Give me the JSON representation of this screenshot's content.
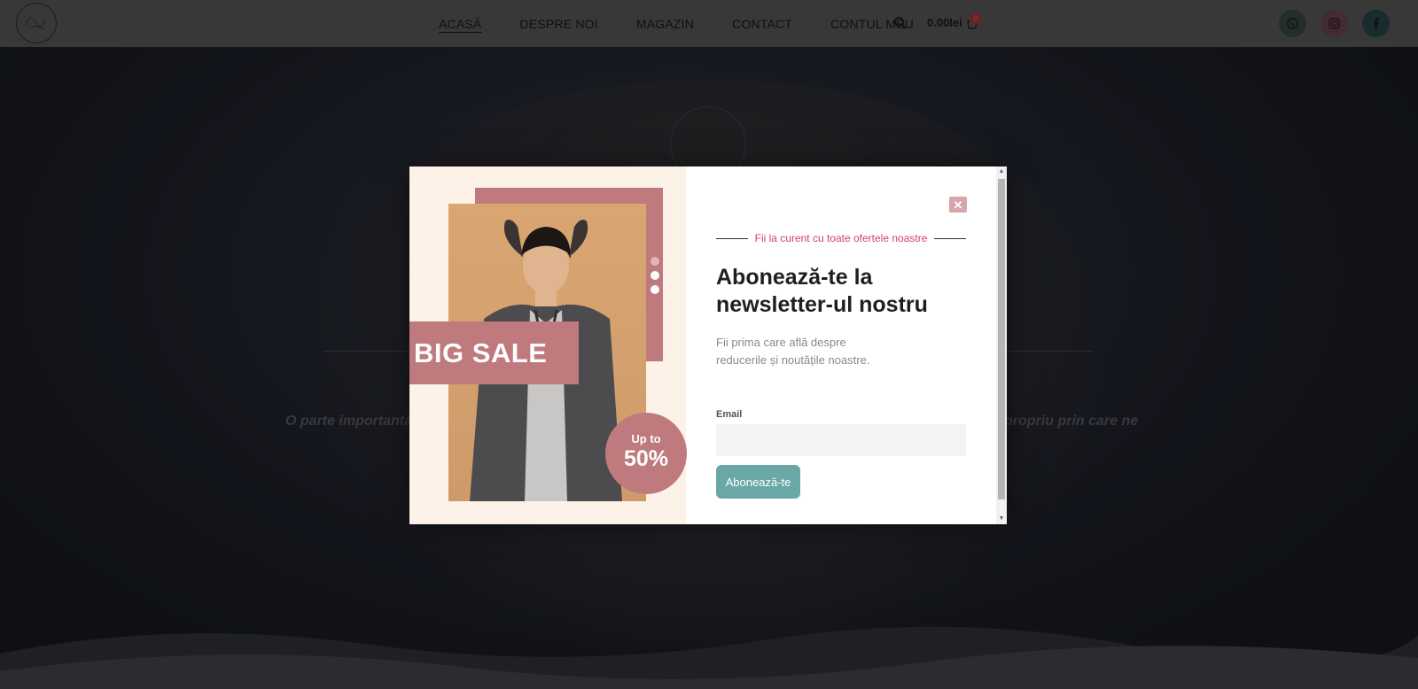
{
  "header": {
    "nav": [
      "ACASĂ",
      "DESPRE NOI",
      "MAGAZIN",
      "CONTACT",
      "CONTUL MEU"
    ],
    "cart_total": "0.00lei",
    "cart_count": "0",
    "icons": [
      "search-icon",
      "cart-icon",
      "whatsapp-icon",
      "instagram-icon",
      "facebook-icon"
    ],
    "social_colors": {
      "whatsapp": "#2f3e38",
      "instagram": "#5a3a47",
      "facebook": "#233a40"
    }
  },
  "hero": {
    "text_left": "O parte importantă",
    "text_right": "propriu prin care ne"
  },
  "popup": {
    "sale_label": "BIG SALE",
    "badge_upto": "Up to",
    "badge_percent": "50%",
    "eyebrow": "Fii la curent cu toate ofertele noastre",
    "title": "Abonează-te la newsletter-ul nostru",
    "description": "Fii prima care află despre reducerile și noutățile noastre.",
    "email_label": "Email",
    "email_value": "",
    "submit_label": "Abonează-te",
    "colors": {
      "accent_rose": "#be7a7d",
      "eyebrow": "#d23d78",
      "button": "#69a8a6",
      "panel_bg": "#fdf2e8"
    }
  }
}
